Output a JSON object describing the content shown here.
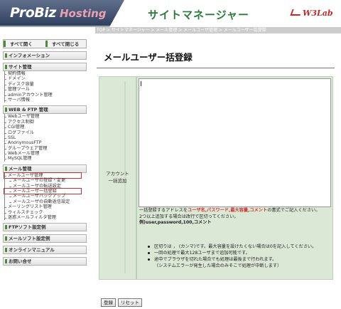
{
  "header": {
    "logo_main": "ProBiz",
    "logo_sub": "Hosting",
    "title": "サイトマネージャー",
    "w3lab": "W3Lab"
  },
  "breadcrumb": "TOP > サイトマネージャー > メール管理 > メールユーザ管理 > メールユーザー括登録",
  "sidebar": {
    "open_all": "すべて開く",
    "close_all": "すべて閉じる",
    "sections": [
      {
        "label": "インフォメーション",
        "items": []
      },
      {
        "label": "サイト管理",
        "items": [
          "契約情報",
          "ドメイン",
          "ディスク容量",
          "管理ツール",
          "adminアカウント管理",
          "サーバ情報"
        ]
      },
      {
        "label": "WEB & FTP 管理",
        "items": [
          "Webユーザ管理",
          "アクセス制御",
          "CGI管理",
          "ログファイル",
          "SSL",
          "AnonymousFTP",
          "グループウェア管理",
          "Webメール管理",
          "MySQL管理"
        ]
      },
      {
        "label": "メール管理",
        "items": [
          "メールユーザ管理",
          "メールユーザの登録・変更",
          "メールユーザの転送設定",
          "メールユーザ一括登録",
          "メールユーザバックアップ",
          "メールユーザの自動返信設定",
          "メーリングリスト管理",
          "ウィルスチェック",
          "迷惑メールフィルタ管理"
        ]
      },
      {
        "label": "FTPソフト設定例",
        "items": []
      },
      {
        "label": "メールソフト設定例",
        "items": []
      },
      {
        "label": "オンラインマニュアル",
        "items": []
      },
      {
        "label": "お問い合せ",
        "items": []
      }
    ]
  },
  "main": {
    "title": "メールユーザー括登録",
    "field_label_1": "アカウント",
    "field_label_2": "一括追加",
    "desc_1a": "一括登録するアドレスを",
    "desc_1b": "ユーザ名,パスワード,最大容量,コメント",
    "desc_1c": "の書式でご記入ください。",
    "desc_2": "2つ以上追加する場合は改行で区切ってください。",
    "desc_3": "例)user,password,100,コメント",
    "bullets": [
      "区切りは ， (カンマ)です。最大容量を設けたくない場合は0を記入してください。",
      "一回の処理で最大128ユーザまで追加可能です。",
      "途中でブラウザを切れた場合でも処理は最後まで行われます。",
      "（システムエラーが発生した場合のみそこで処理が中断します）"
    ],
    "submit_label": "登録",
    "reset_label": "リセット"
  }
}
